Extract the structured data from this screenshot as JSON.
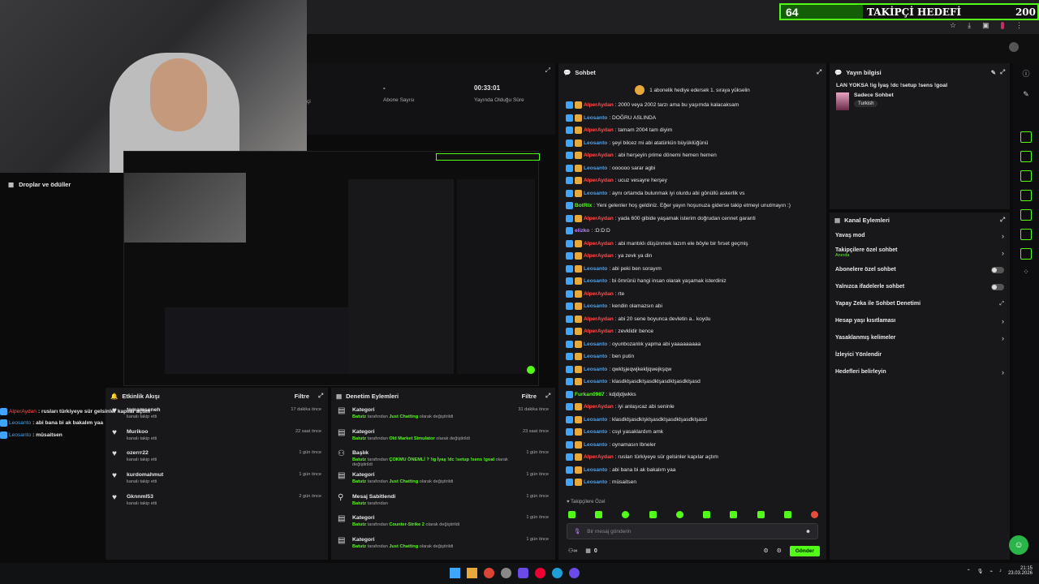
{
  "goal_bar": {
    "current": "64",
    "title": "TAKİPÇİ HEDEFİ",
    "target": "200"
  },
  "stats": {
    "abone_value": "-",
    "abone_label": "Abone Sayısı",
    "time_value": "00:33:01",
    "time_label": "Yayında Olduğu Süre",
    "partial_label": "çi"
  },
  "drops": {
    "label": "Droplar ve ödüller"
  },
  "chat": {
    "title": "Sohbet",
    "gift_banner": "1 abonelik hediye edersek 1. sıraya yükselin",
    "lines": [
      {
        "user": "AlperAydan",
        "color": "#ff4d4d",
        "msg": ": 2000 veya 2002 tarzı ama bu yaşımda kalacaksam"
      },
      {
        "user": "Leosanto",
        "color": "#3ea6ff",
        "msg": ": DOĞRU ASLINDA"
      },
      {
        "user": "AlperAydan",
        "color": "#ff4d4d",
        "msg": ": tamam 2004 tam diyim"
      },
      {
        "user": "Leosanto",
        "color": "#3ea6ff",
        "msg": ": şeyi bilcez mi abi atatürkün büyüklüğünü"
      },
      {
        "user": "AlperAydan",
        "color": "#ff4d4d",
        "msg": ": abi herşeyin prime dönemi hemen hemen"
      },
      {
        "user": "Leosanto",
        "color": "#3ea6ff",
        "msg": ": oooooo sarar agbi"
      },
      {
        "user": "AlperAydan",
        "color": "#ff4d4d",
        "msg": ": ucuz vesayre herşey"
      },
      {
        "user": "Leosanto",
        "color": "#3ea6ff",
        "msg": ": aynı ortamda bulunmak iyi olurdu abi gönüllü askerlik vs"
      },
      {
        "user": "BotRix",
        "color": "#53fc18",
        "msg": ": Yeni gelenler hoş geldiniz. Eğer yayın hoşunuza giderse takip etmeyi unutmayın :)"
      },
      {
        "user": "AlperAydan",
        "color": "#ff4d4d",
        "msg": ": yada 600 gibide yaşamak isterim doğrudan cennet garanti"
      },
      {
        "user": "elizko",
        "color": "#b983ff",
        "msg": ": :D:D:D"
      },
      {
        "user": "AlperAydan",
        "color": "#ff4d4d",
        "msg": ": abi mantıklı düşünmek lazım ele böyle bir fırset geçmiş"
      },
      {
        "user": "AlperAydan",
        "color": "#ff4d4d",
        "msg": ": ya zevk ya din"
      },
      {
        "user": "Leosanto",
        "color": "#3ea6ff",
        "msg": ": abi peki ben sorayım"
      },
      {
        "user": "Leosanto",
        "color": "#3ea6ff",
        "msg": ": bi ömrünü hangi insan olarak yaşamak isterdiniz"
      },
      {
        "user": "AlperAydan",
        "color": "#ff4d4d",
        "msg": ": rte"
      },
      {
        "user": "Leosanto",
        "color": "#3ea6ff",
        "msg": ": kendin olamazsın abi"
      },
      {
        "user": "AlperAydan",
        "color": "#ff4d4d",
        "msg": ": abi 20 sene boyunca devletin a.. koydu"
      },
      {
        "user": "AlperAydan",
        "color": "#ff4d4d",
        "msg": ": zevklidir bence"
      },
      {
        "user": "Leosanto",
        "color": "#3ea6ff",
        "msg": ": oyunbozanlık yapma abi yaaaaaaaaa"
      },
      {
        "user": "Leosanto",
        "color": "#3ea6ff",
        "msg": ": ben putin"
      },
      {
        "user": "Leosanto",
        "color": "#3ea6ff",
        "msg": ": qwklşjeqwjkekljqwejkşqw"
      },
      {
        "user": "Leosanto",
        "color": "#3ea6ff",
        "msg": ": klasdklşasdklşasdklşasdklşasdklşasd"
      },
      {
        "user": "Furkan0987",
        "color": "#53fc18",
        "msg": ": kdjdjdjwkks"
      },
      {
        "user": "AlperAydan",
        "color": "#ff4d4d",
        "msg": ": iyi anlaşıcaz abi seninle"
      },
      {
        "user": "Leosanto",
        "color": "#3ea6ff",
        "msg": ": klasdklşasdklşklşasdklşasdklşasdklşasd"
      },
      {
        "user": "Leosanto",
        "color": "#3ea6ff",
        "msg": ": csyi yasaklardım amk"
      },
      {
        "user": "Leosanto",
        "color": "#3ea6ff",
        "msg": ": oynamasın lbneler"
      },
      {
        "user": "AlperAydan",
        "color": "#ff4d4d",
        "msg": ": rusları türkiyeye sür gelsinler kapılar açtım"
      },
      {
        "user": "Leosanto",
        "color": "#3ea6ff",
        "msg": ": abi bana bi ak bakalım yaa"
      },
      {
        "user": "Leosanto",
        "color": "#3ea6ff",
        "msg": ": müsaitsen"
      }
    ],
    "followers_only": "Takipçilere Özel",
    "input_placeholder": "Bir mesaj gönderin",
    "count": "0",
    "send": "Gönder"
  },
  "overlay_chat": [
    {
      "user": "AlperAydan",
      "color": "#ff4d4d",
      "msg": ": rusları türkiyeye sür gelsinler kapılar açtım"
    },
    {
      "user": "Leosanto",
      "color": "#3ea6ff",
      "msg": ": abi bana bi ak bakalım yaa"
    },
    {
      "user": "Leosanto",
      "color": "#3ea6ff",
      "msg": ": müsaitsen"
    }
  ],
  "stream_info": {
    "title": "Yayın bilgisi",
    "stream_title": "LAN YOKSA !ig İyaş !dc !setup !sens !goal",
    "category": "Sadece Sohbet",
    "language": "Turkish"
  },
  "channel_actions": {
    "title": "Kanal Eylemleri",
    "items": [
      {
        "label": "Yavaş mod",
        "sub": "",
        "control": "chevron"
      },
      {
        "label": "Takipçilere özel sohbet",
        "sub": "Anında",
        "control": "chevron"
      },
      {
        "label": "Abonelere özel sohbet",
        "sub": "",
        "control": "toggle"
      },
      {
        "label": "Yalnızca ifadelerle sohbet",
        "sub": "",
        "control": "toggle"
      },
      {
        "label": "Yapay Zeka ile Sohbet Denetimi",
        "sub": "",
        "control": "external"
      },
      {
        "label": "Hesap yaşı kısıtlaması",
        "sub": "",
        "control": "chevron"
      },
      {
        "label": "Yasaklanmış kelimeler",
        "sub": "",
        "control": "chevron"
      },
      {
        "label": "İzleyici Yönlendir",
        "sub": "",
        "control": "none"
      },
      {
        "label": "Hedefleri belirleyin",
        "sub": "",
        "control": "chevron"
      }
    ]
  },
  "activity": {
    "title": "Etkinlik Akışı",
    "filter": "Filtre",
    "items": [
      {
        "name": "tamamseneh",
        "sub": "kanalı takip etti",
        "time": "17 dakika önce"
      },
      {
        "name": "Murikoo",
        "sub": "kanalı takip etti",
        "time": "22 saat önce"
      },
      {
        "name": "ozerrr22",
        "sub": "kanalı takip etti",
        "time": "1 gün önce"
      },
      {
        "name": "kurdomahmut",
        "sub": "kanalı takip etti",
        "time": "1 gün önce"
      },
      {
        "name": "Gknnml53",
        "sub": "kanalı takip etti",
        "time": "2 gün önce"
      }
    ]
  },
  "moderation": {
    "title": "Denetim Eylemleri",
    "filter": "Filtre",
    "items": [
      {
        "type": "Kategori",
        "actor": "Batutz",
        "mid": " tarafından ",
        "obj": "Just Chatting",
        "suffix": " olarak değiştirildi",
        "time": "31 dakika önce",
        "icon": "category"
      },
      {
        "type": "Kategori",
        "actor": "Batutz",
        "mid": " tarafından ",
        "obj": "Old Market Simulator",
        "suffix": " olarak değiştirildi",
        "time": "23 saat önce",
        "icon": "category"
      },
      {
        "type": "Başlık",
        "actor": "Batutz",
        "mid": " tarafından ",
        "obj": "ÇOKMU ÖNEMLİ ? !ig İyaş !dc !setup !sens !goal",
        "suffix": " olarak değiştirildi",
        "time": "1 gün önce",
        "icon": "title"
      },
      {
        "type": "Kategori",
        "actor": "Batutz",
        "mid": " tarafından ",
        "obj": "Just Chatting",
        "suffix": " olarak değiştirildi",
        "time": "1 gün önce",
        "icon": "category"
      },
      {
        "type": "Mesaj Sabitlendi",
        "actor": "Batutz",
        "mid": " tarafından",
        "obj": "",
        "suffix": "",
        "time": "1 gün önce",
        "icon": "pin"
      },
      {
        "type": "Kategori",
        "actor": "Batutz",
        "mid": " tarafından ",
        "obj": "Counter-Strike 2",
        "suffix": " olarak değiştirildi",
        "time": "1 gün önce",
        "icon": "category"
      },
      {
        "type": "Kategori",
        "actor": "Batutz",
        "mid": " tarafından ",
        "obj": "Just Chatting",
        "suffix": " olarak değiştirildi",
        "time": "1 gün önce",
        "icon": "category"
      }
    ]
  },
  "taskbar": {
    "time": "21:15",
    "date": "23.03.2026"
  }
}
